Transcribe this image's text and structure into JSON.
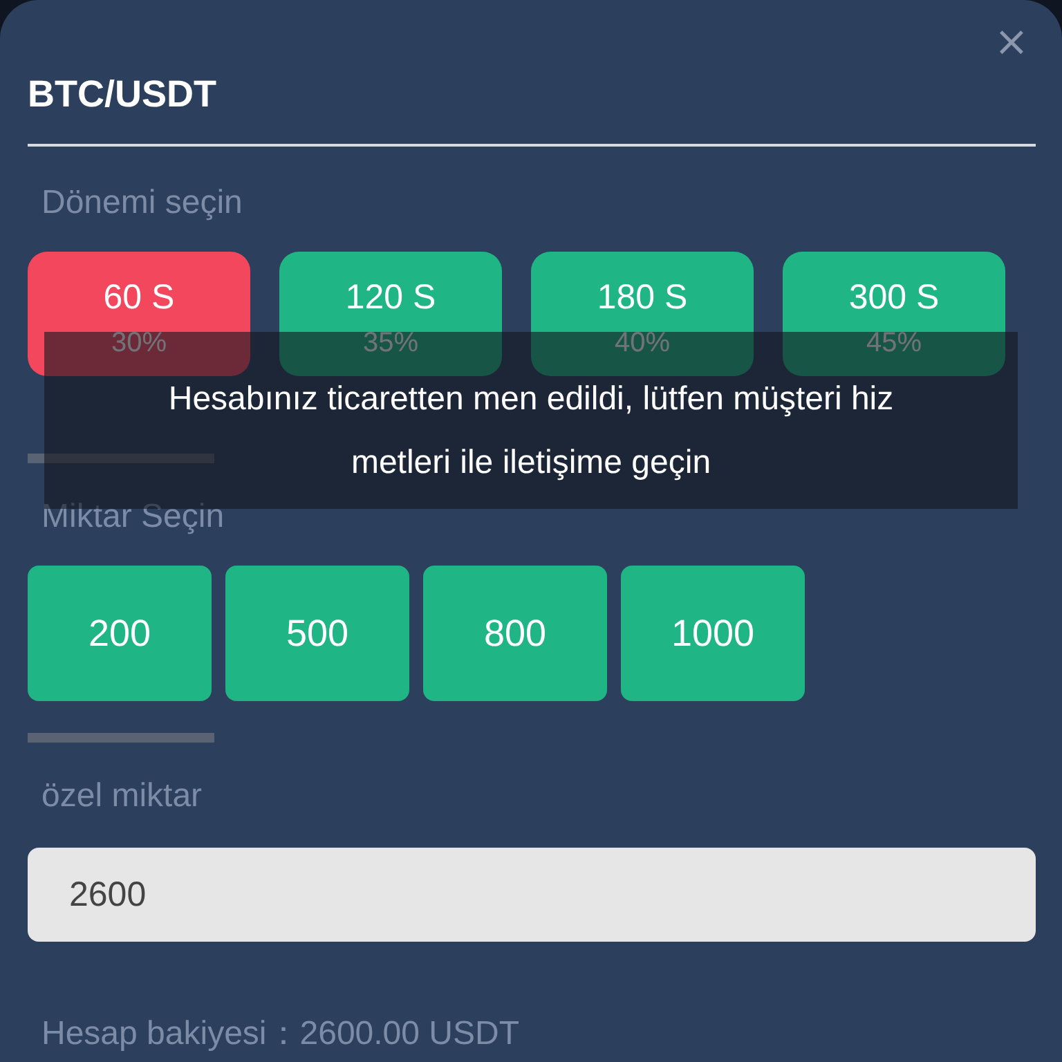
{
  "dialog": {
    "title": "BTC/USDT",
    "close": "×"
  },
  "period": {
    "label": "Dönemi seçin",
    "options": [
      {
        "time": "60 S",
        "rate": "30%",
        "selected": true
      },
      {
        "time": "120 S",
        "rate": "35%",
        "selected": false
      },
      {
        "time": "180 S",
        "rate": "40%",
        "selected": false
      },
      {
        "time": "300 S",
        "rate": "45%",
        "selected": false
      }
    ]
  },
  "amount": {
    "label": "Miktar Seçin",
    "options": [
      "200",
      "500",
      "800",
      "1000"
    ]
  },
  "custom_amount": {
    "label": "özel miktar",
    "value": "2600"
  },
  "balance": {
    "label": "Hesap bakiyesi：",
    "value": "2600.00 USDT"
  },
  "toast": {
    "message": "Hesabınız ticaretten men edildi, lütfen müşteri hiz metleri ile iletişime geçin"
  }
}
